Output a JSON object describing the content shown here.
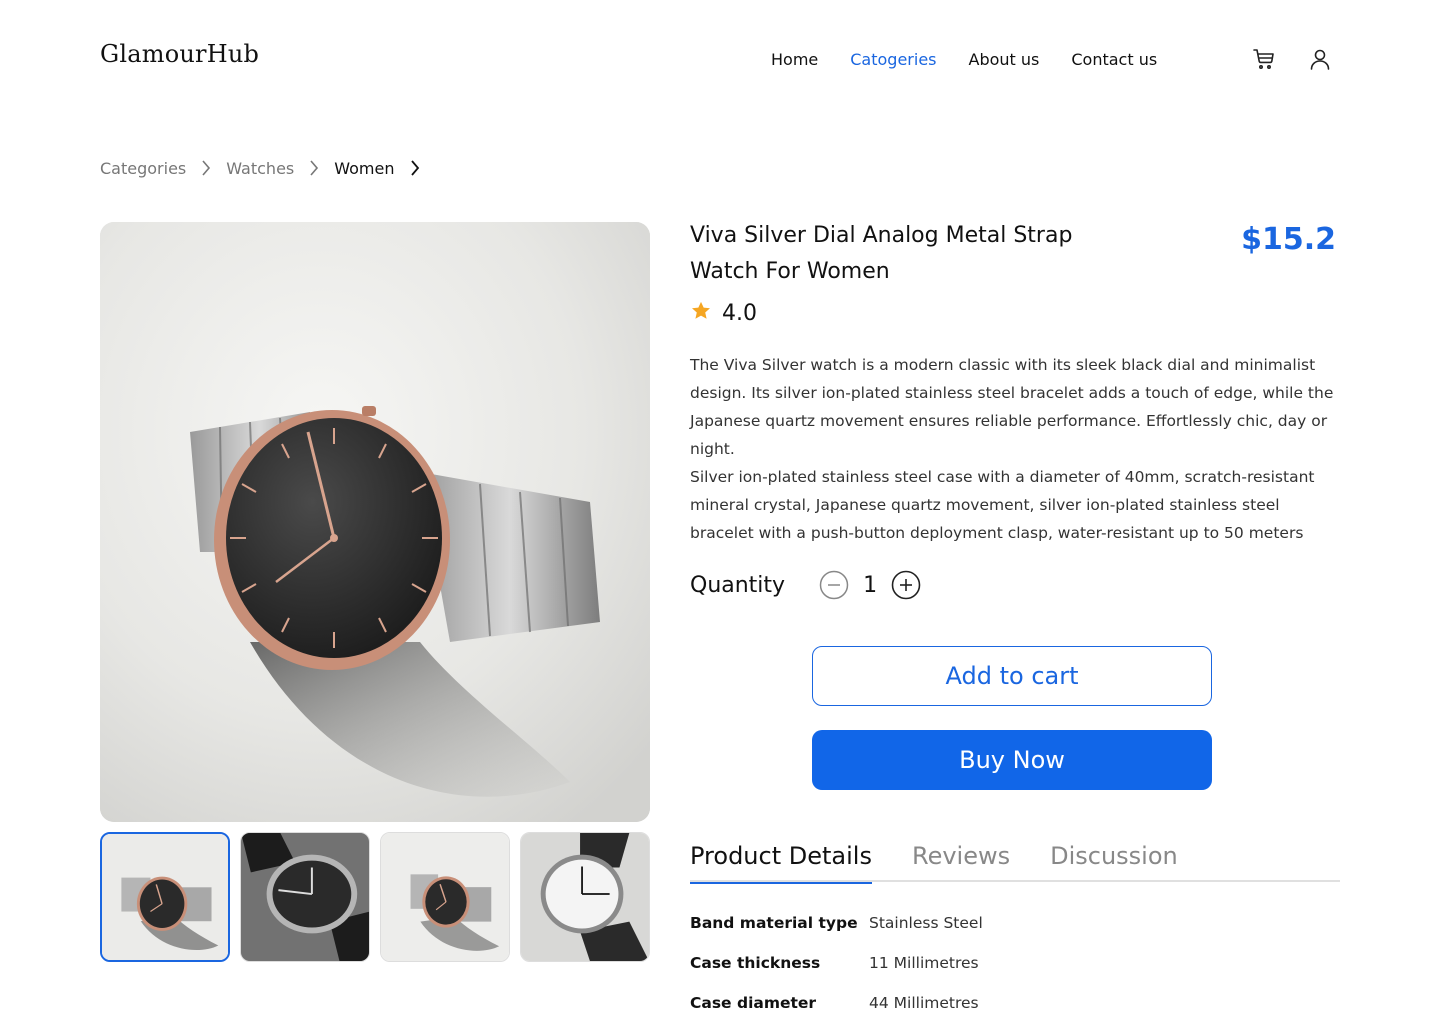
{
  "brand": {
    "logo": "GlamourHub"
  },
  "nav": {
    "items": [
      {
        "label": "Home"
      },
      {
        "label": "Catogeries"
      },
      {
        "label": "About us"
      },
      {
        "label": "Contact us"
      }
    ],
    "active_index": 1
  },
  "header_icons": [
    "cart-icon",
    "user-icon"
  ],
  "breadcrumb": {
    "items": [
      "Categories",
      "Watches",
      "Women"
    ]
  },
  "product": {
    "title": "Viva Silver Dial Analog Metal Strap Watch For Women",
    "price": "$15.2",
    "rating": "4.0",
    "description_1": "The Viva Silver watch is a modern classic with its sleek black dial and minimalist design. Its silver ion-plated stainless steel bracelet adds a touch of edge, while the Japanese quartz movement ensures reliable performance. Effortlessly chic, day or night.",
    "description_2": "Silver ion-plated stainless steel case with a diameter of 40mm, scratch-resistant mineral crystal, Japanese quartz movement, silver ion-plated stainless steel bracelet with a push-button deployment clasp, water-resistant up to 50 meters",
    "quantity_label": "Quantity",
    "quantity": "1",
    "add_to_cart": "Add to cart",
    "buy_now": "Buy Now"
  },
  "tabs": [
    {
      "label": "Product Details"
    },
    {
      "label": "Reviews"
    },
    {
      "label": "Discussion"
    }
  ],
  "details": [
    {
      "key": "Band material type",
      "value": "Stainless Steel"
    },
    {
      "key": "Case thickness",
      "value": "11 Millimetres"
    },
    {
      "key": "Case diameter",
      "value": "44 Millimetres"
    }
  ],
  "colors": {
    "accent": "#1a66e0",
    "star": "#f5a623",
    "text": "#111111"
  }
}
